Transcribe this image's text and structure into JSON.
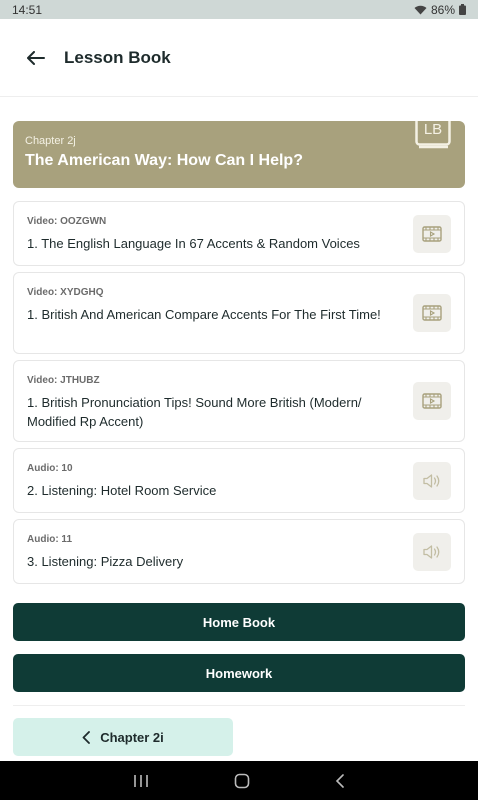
{
  "status_bar": {
    "time": "14:51",
    "battery": "86%"
  },
  "header": {
    "title": "Lesson Book"
  },
  "chapter": {
    "subtitle": "Chapter 2j",
    "title": "The American Way: How Can I Help?",
    "logo_text": "LB"
  },
  "items": [
    {
      "kind": "Video: OOZGWN",
      "title": "1. The English Language In 67 Accents & Random Voices",
      "icon": "video-icon"
    },
    {
      "kind": "Video: XYDGHQ",
      "title": "1. British And American Compare Accents For The First Time!",
      "icon": "video-icon"
    },
    {
      "kind": "Video: JTHUBZ",
      "title": "1. British Pronunciation Tips! Sound More British (Modern/ Modified Rp Accent)",
      "icon": "video-icon"
    },
    {
      "kind": "Audio: 10",
      "title": "2. Listening: Hotel Room Service",
      "icon": "speaker-icon"
    },
    {
      "kind": "Audio: 11",
      "title": "3. Listening: Pizza Delivery",
      "icon": "speaker-icon"
    }
  ],
  "buttons": {
    "home_book": "Home Book",
    "homework": "Homework",
    "previous_chapter": "Chapter 2i"
  },
  "colors": {
    "accent": "#0f3b36",
    "chapter_bg": "#a8a17d",
    "prev_bg": "#d5f1ea"
  }
}
